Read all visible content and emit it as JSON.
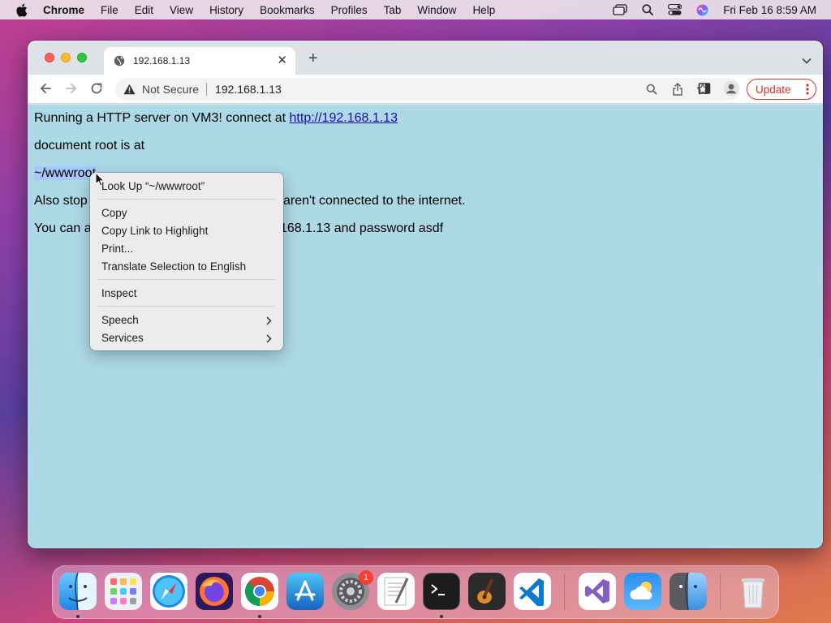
{
  "menubar": {
    "app_name": "Chrome",
    "items": [
      "File",
      "Edit",
      "View",
      "History",
      "Bookmarks",
      "Profiles",
      "Tab",
      "Window",
      "Help"
    ],
    "clock": "Fri Feb 16  8:59 AM"
  },
  "browser": {
    "tab": {
      "title": "192.168.1.13"
    },
    "address": {
      "security": "Not Secure",
      "url": "192.168.1.13"
    },
    "update_label": "Update"
  },
  "page": {
    "line1_text": "Running a HTTP server on VM3! connect at ",
    "line1_link": "http://192.168.1.13",
    "line2": "document root is at",
    "line3": "~/wwwroot",
    "line4_start": "Also stop",
    "line4_end": "aren't connected to the internet.",
    "line5_start": "You can a",
    "line5_end": "168.1.13 and password asdf"
  },
  "context_menu": {
    "look_up": "Look Up “~/wwwroot”",
    "copy": "Copy",
    "copy_link": "Copy Link to Highlight",
    "print": "Print...",
    "translate": "Translate Selection to English",
    "inspect": "Inspect",
    "speech": "Speech",
    "services": "Services"
  },
  "dock": {
    "apps": [
      "finder",
      "launchpad",
      "safari",
      "firefox",
      "chrome",
      "app-store",
      "system-preferences",
      "textedit",
      "terminal",
      "garageband",
      "vscode",
      "visual-studio",
      "weather",
      "finder-alt",
      "trash"
    ],
    "system_preferences_badge": "1"
  },
  "colors": {
    "page_background": "#add8e6",
    "link": "#1a0dab",
    "update_accent": "#d93025",
    "selection": "#a8c7fa"
  }
}
